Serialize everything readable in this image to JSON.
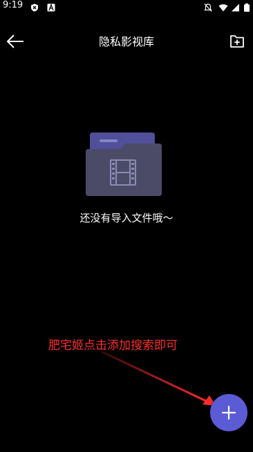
{
  "status_bar": {
    "time": "9:19",
    "left_icons": [
      "shield-icon",
      "font-a-icon"
    ],
    "right_icons": [
      "notifications-off-icon",
      "wifi-icon",
      "signal-icon",
      "battery-icon"
    ]
  },
  "header": {
    "title": "隐私影视库",
    "back_icon": "arrow-left-icon",
    "action_icon": "folder-add-icon"
  },
  "empty_state": {
    "icon": "video-folder-icon",
    "message": "还没有导入文件哦～"
  },
  "annotation": {
    "text": "肥宅姬点击添加搜索即可",
    "color": "#ff2b2b"
  },
  "fab": {
    "icon": "plus-icon",
    "color": "#5b5bd6"
  },
  "colors": {
    "background": "#000000",
    "folder_back": "#4f4f9a",
    "folder_front": "#4b4b68"
  }
}
